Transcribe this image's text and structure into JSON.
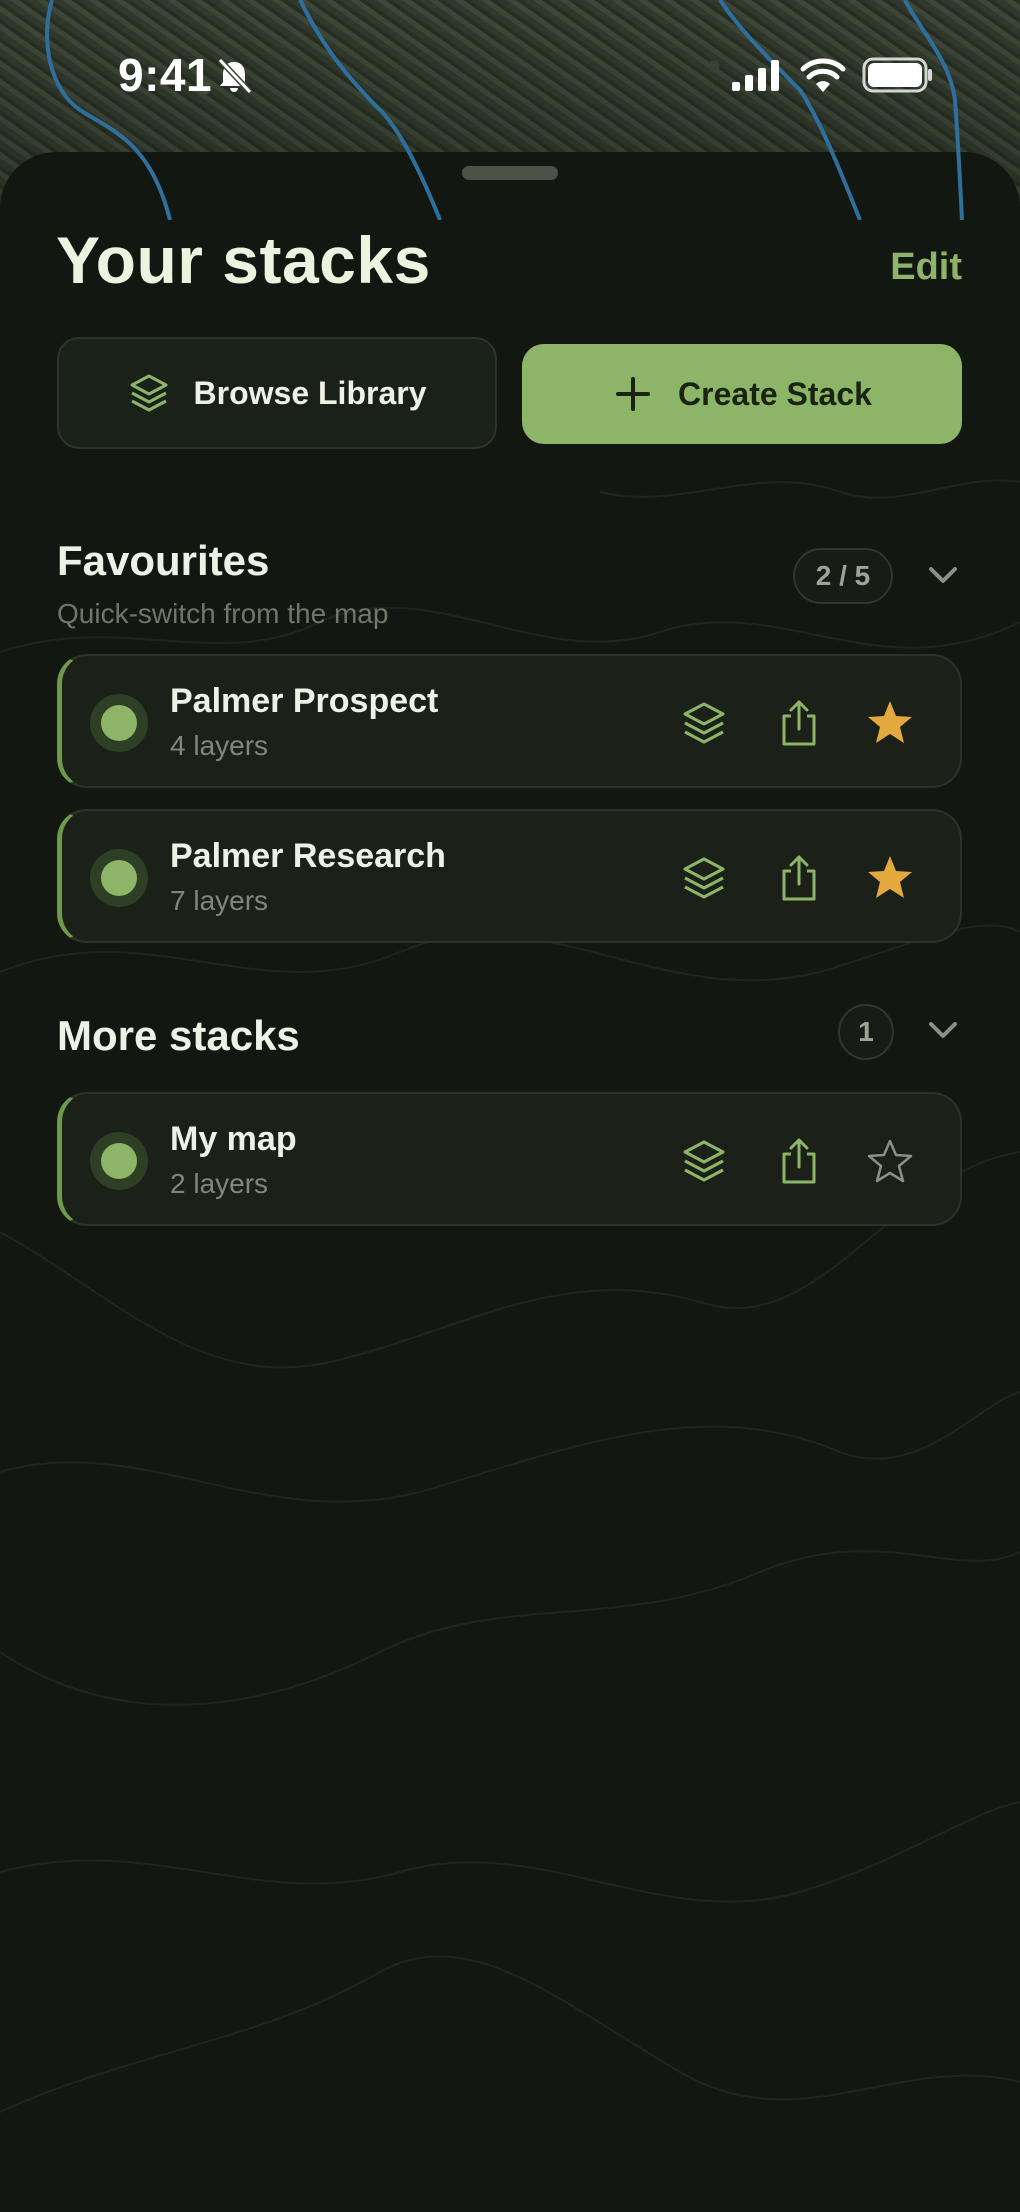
{
  "status_bar": {
    "time": "9:41"
  },
  "sheet": {
    "title": "Your stacks",
    "edit_label": "Edit",
    "browse_label": "Browse Library",
    "create_label": "Create Stack"
  },
  "favourites": {
    "title": "Favourites",
    "subtitle": "Quick-switch from the map",
    "count": "2 / 5",
    "items": [
      {
        "name": "Palmer Prospect",
        "layers": "4 layers",
        "favourite": true
      },
      {
        "name": "Palmer Research",
        "layers": "7 layers",
        "favourite": true
      }
    ]
  },
  "more_stacks": {
    "title": "More stacks",
    "count": "1",
    "items": [
      {
        "name": "My map",
        "layers": "2 layers",
        "favourite": false
      }
    ]
  },
  "colors": {
    "accent": "#8db567",
    "star_active": "#e3a93c",
    "sheet_background": "#121811",
    "card_background": "#1b2119"
  },
  "icons": {
    "browse": "layers-icon",
    "create": "plus-icon",
    "card_actions": [
      "layers-icon",
      "share-icon",
      "star-icon"
    ],
    "section_toggle": "chevron-down-icon"
  }
}
